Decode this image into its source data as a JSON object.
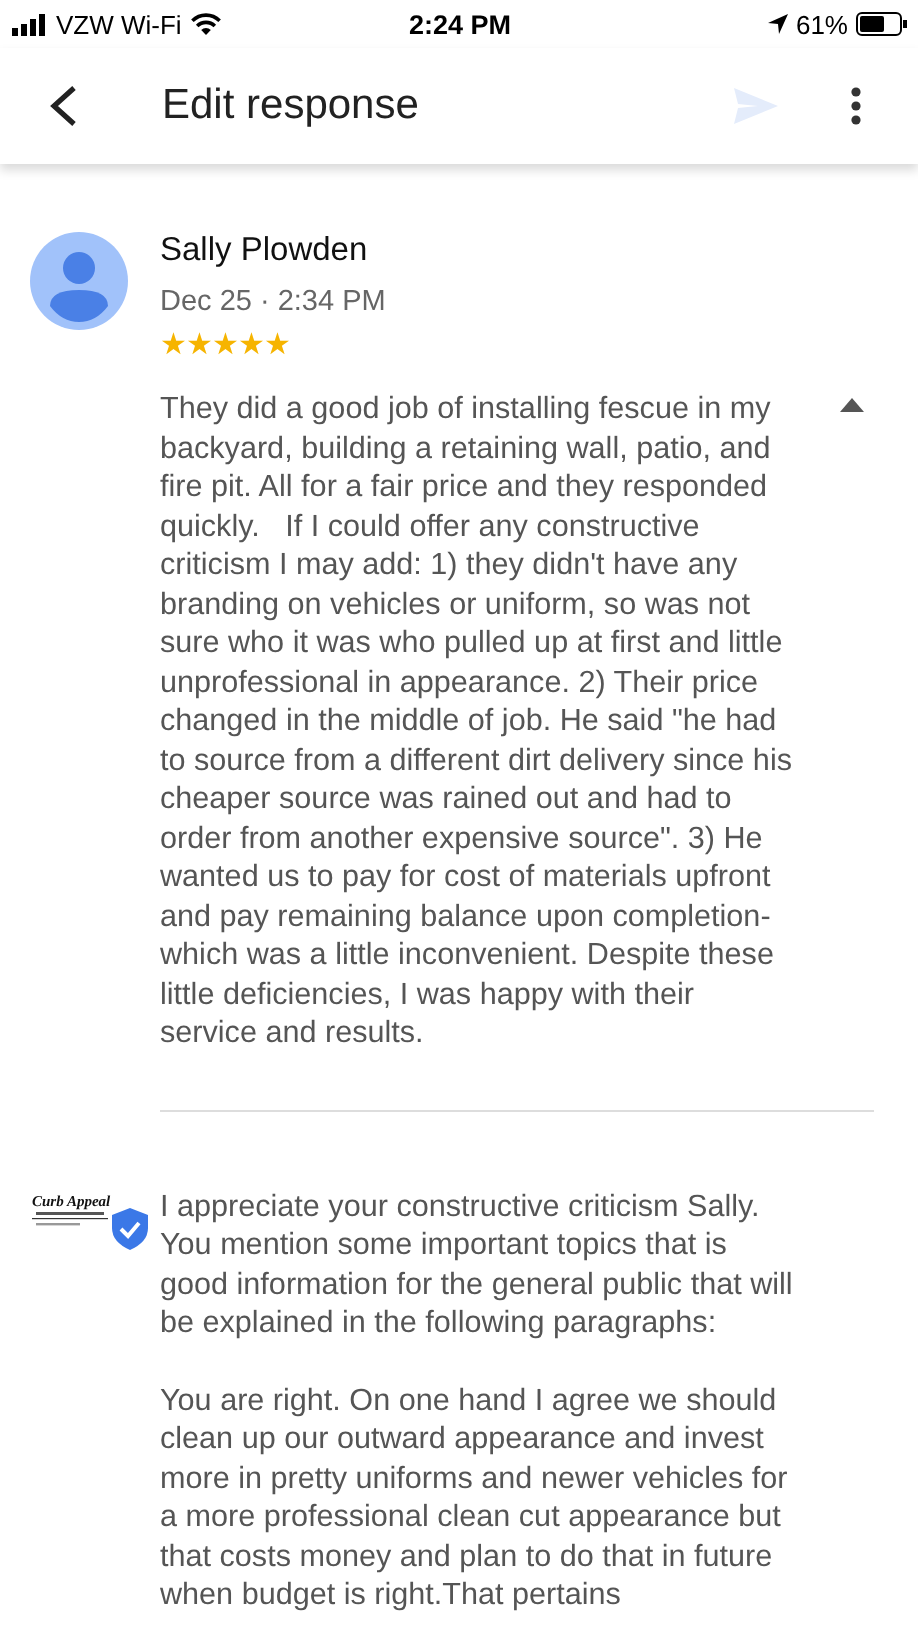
{
  "status_bar": {
    "carrier": "VZW Wi-Fi",
    "time": "2:24 PM",
    "battery": "61%"
  },
  "header": {
    "title": "Edit response",
    "send_disabled": true
  },
  "review": {
    "author": "Sally Plowden",
    "date": "Dec 25 · 2:34 PM",
    "stars": 5,
    "expanded": true,
    "text": "They did a good job of installing fescue in my backyard, building a retaining wall, patio, and fire pit. All for a fair price and they responded quickly.   If I could offer any constructive criticism I may add: 1) they didn't have any branding on vehicles or uniform, so was not sure who it was who pulled up at first and little unprofessional in appearance. 2) Their price changed in the middle of job. He said \"he had to source from a different dirt delivery since his cheaper source was rained out and had to order from another expensive source\". 3) He wanted us to pay for cost of materials upfront and pay remaining balance upon completion- which was a little inconvenient. Despite these little deficiencies, I was happy with their service and results."
  },
  "response": {
    "logo_text": "Curb Appeal",
    "verified": true,
    "paragraphs": [
      "I appreciate your constructive criticism Sally. You mention some important topics that is good information for the general public that will be explained in the following paragraphs:",
      "You are right. On one hand I agree we should clean up our outward appearance and invest more in pretty uniforms and newer vehicles for a more professional clean cut appearance but that costs money and plan to do that in future when budget is right.That pertains"
    ]
  }
}
